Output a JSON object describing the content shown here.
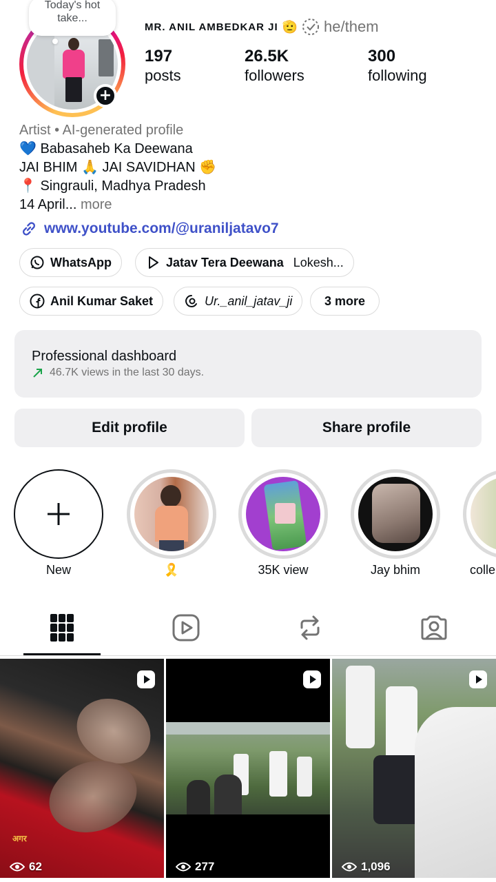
{
  "profile": {
    "note": "Today's hot take...",
    "username": "MR. ANIL AMBEDKAR JI",
    "username_emoji": "🫡",
    "pronouns": "he/them",
    "stats": [
      {
        "value": "197",
        "label": "posts"
      },
      {
        "value": "26.5K",
        "label": "followers"
      },
      {
        "value": "300",
        "label": "following"
      }
    ]
  },
  "bio": {
    "category": "Artist • AI-generated profile",
    "lines": [
      "💙 Babasaheb Ka Deewana",
      "JAI BHIM 🙏 JAI SAVIDHAN ✊",
      "📍 Singrauli, Madhya Pradesh"
    ],
    "truncated": "14 April...",
    "more": "more",
    "link": "www.youtube.com/@uraniljatavo7"
  },
  "chips": {
    "whatsapp": "WhatsApp",
    "music_title": "Jatav Tera Deewana",
    "music_artist": "Lokesh...",
    "facebook": "Anil Kumar Saket",
    "threads": "Ur._anil_jatav_ji",
    "more": "3 more"
  },
  "dashboard": {
    "title": "Professional dashboard",
    "subtitle": "46.7K views in the last 30 days."
  },
  "buttons": {
    "edit": "Edit profile",
    "share": "Share profile"
  },
  "highlights": [
    {
      "label": "New"
    },
    {
      "label": "🎗️"
    },
    {
      "label": "35K view"
    },
    {
      "label": "Jay bhim"
    },
    {
      "label": "colle"
    }
  ],
  "posts": [
    {
      "views": "62",
      "caption": "अगर"
    },
    {
      "views": "277"
    },
    {
      "views": "1,096"
    }
  ],
  "colors": {
    "link": "#3f51c8",
    "muted": "#737373",
    "panel": "#efeff1"
  }
}
